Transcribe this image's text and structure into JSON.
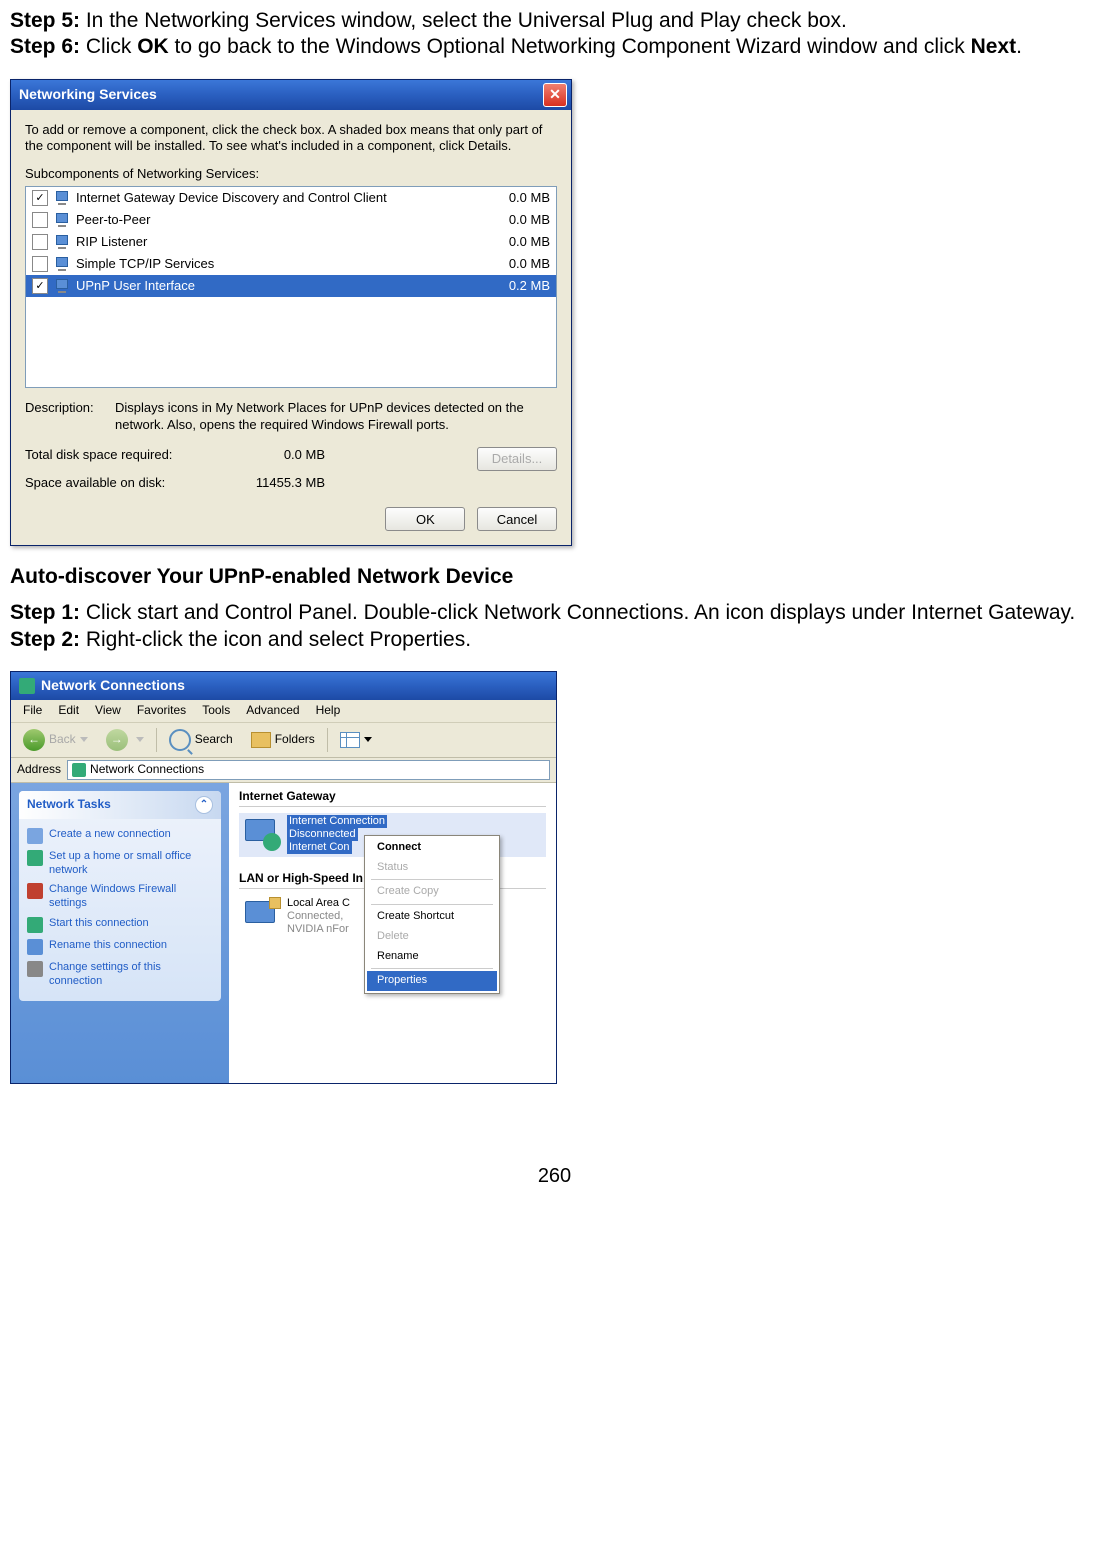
{
  "steps": {
    "s5_label": "Step 5:",
    "s5_text": " In the Networking Services window, select the Universal Plug and Play check box.",
    "s6_label": "Step 6:",
    "s6_pre": " Click ",
    "s6_ok": "OK",
    "s6_mid": " to go back to the Windows Optional Networking Component Wizard window and click ",
    "s6_next": "Next",
    "s6_post": "."
  },
  "dialog1": {
    "title": "Networking Services",
    "close_glyph": "✕",
    "intro": "To add or remove a component, click the check box. A shaded box means that only part of the component will be installed. To see what's included in a component, click Details.",
    "sub_label": "Subcomponents of Networking Services:",
    "items": [
      {
        "checked": true,
        "name": "Internet Gateway Device Discovery and Control Client",
        "size": "0.0 MB",
        "selected": false
      },
      {
        "checked": false,
        "name": "Peer-to-Peer",
        "size": "0.0 MB",
        "selected": false
      },
      {
        "checked": false,
        "name": "RIP Listener",
        "size": "0.0 MB",
        "selected": false
      },
      {
        "checked": false,
        "name": "Simple TCP/IP Services",
        "size": "0.0 MB",
        "selected": false
      },
      {
        "checked": true,
        "name": "UPnP User Interface",
        "size": "0.2 MB",
        "selected": true
      }
    ],
    "desc_label": "Description:",
    "desc_text": "Displays icons in My Network Places for UPnP devices detected on the network. Also, opens the required Windows Firewall ports.",
    "total_label": "Total disk space required:",
    "total_val": "0.0 MB",
    "avail_label": "Space available on disk:",
    "avail_val": "11455.3 MB",
    "details_btn": "Details...",
    "ok_btn": "OK",
    "cancel_btn": "Cancel"
  },
  "section_heading": "Auto-discover Your UPnP-enabled Network Device",
  "steps2": {
    "s1_label": "Step 1:",
    "s1_text": " Click start and Control Panel. Double-click Network Connections. An icon displays under Internet Gateway.",
    "s2_label": "Step 2:",
    "s2_text": " Right-click the icon and select Properties."
  },
  "win2": {
    "title": "Network Connections",
    "menus": [
      "File",
      "Edit",
      "View",
      "Favorites",
      "Tools",
      "Advanced",
      "Help"
    ],
    "toolbar": {
      "back": "Back",
      "search": "Search",
      "folders": "Folders"
    },
    "address_label": "Address",
    "address_value": "Network Connections",
    "tasks_header": "Network Tasks",
    "tasks": [
      {
        "label": "Create a new connection",
        "color": "#7aa5e0"
      },
      {
        "label": "Set up a home or small office network",
        "color": "#3a7"
      },
      {
        "label": "Change Windows Firewall settings",
        "color": "#c04030"
      },
      {
        "label": "Start this connection",
        "color": "#3a7"
      },
      {
        "label": "Rename this connection",
        "color": "#5a8fd6"
      },
      {
        "label": "Change settings of this connection",
        "color": "#888"
      }
    ],
    "group1": "Internet Gateway",
    "conn1": {
      "line1": "Internet Connection",
      "line2": "Disconnected",
      "line3": "Internet Con"
    },
    "group2": "LAN or High-Speed In",
    "conn2": {
      "line1": "Local Area C",
      "line2": "Connected, ",
      "line3": "NVIDIA nFor"
    },
    "context_menu": [
      {
        "label": "Connect",
        "type": "bold"
      },
      {
        "label": "Status",
        "type": "disabled"
      },
      {
        "sep": true
      },
      {
        "label": "Create Copy",
        "type": "disabled"
      },
      {
        "sep": true
      },
      {
        "label": "Create Shortcut",
        "type": ""
      },
      {
        "label": "Delete",
        "type": "disabled"
      },
      {
        "label": "Rename",
        "type": ""
      },
      {
        "sep": true
      },
      {
        "label": "Properties",
        "type": "sel"
      }
    ]
  },
  "page_number": "260"
}
